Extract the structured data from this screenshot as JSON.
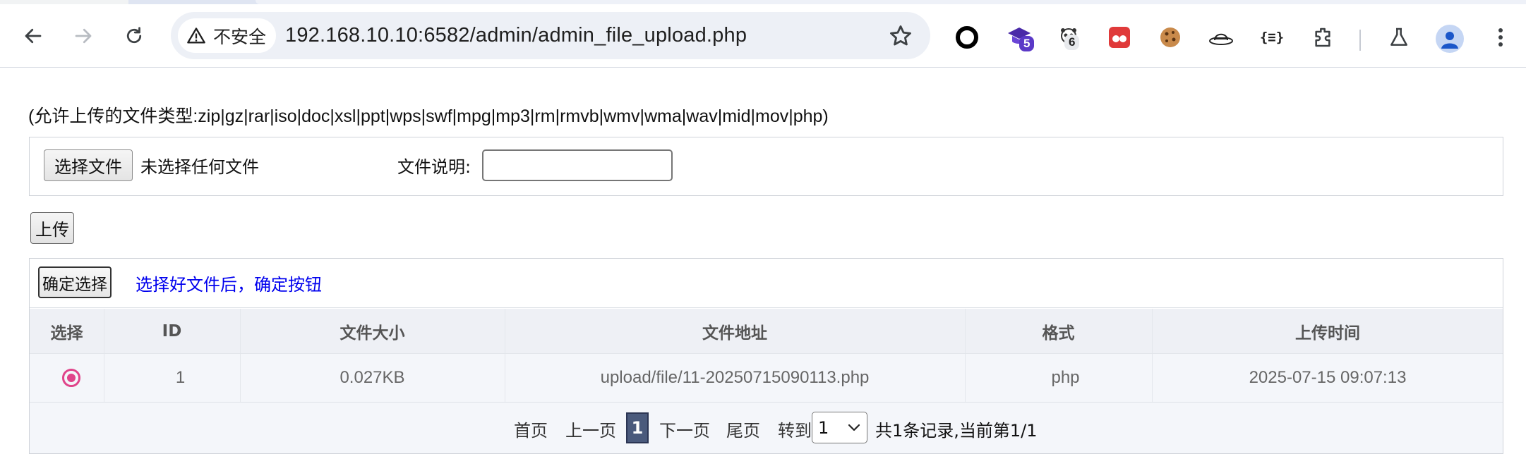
{
  "browser": {
    "security_label": "不安全",
    "url": "192.168.10.10:6582/admin/admin_file_upload.php",
    "extensions": [
      {
        "name": "circle-extension",
        "badge": ""
      },
      {
        "name": "graduation-cap-extension",
        "badge": "5"
      },
      {
        "name": "panda-extension",
        "badge": "6"
      },
      {
        "name": "red-dots-extension",
        "badge": ""
      },
      {
        "name": "cookie-extension",
        "badge": ""
      },
      {
        "name": "hat-extension",
        "badge": ""
      },
      {
        "name": "json-extension",
        "label": "{≡}"
      },
      {
        "name": "puzzle-extension",
        "badge": ""
      }
    ],
    "colors": {
      "accent": "#5b39c7",
      "badge_bg": "#e8eaed"
    }
  },
  "page": {
    "allowed_types": "(允许上传的文件类型:zip|gz|rar|iso|doc|xsl|ppt|wps|swf|mpg|mp3|rm|rmvb|wmv|wma|wav|mid|mov|php)",
    "choose_file_label": "选择文件",
    "no_file_text": "未选择任何文件",
    "description_label": "文件说明:",
    "description_value": "",
    "upload_label": "上传",
    "confirm_label": "确定选择",
    "confirm_hint": "选择好文件后，确定按钮",
    "table": {
      "headers": [
        "选择",
        "ID",
        "文件大小",
        "文件地址",
        "格式",
        "上传时间"
      ],
      "rows": [
        {
          "selected": true,
          "id": "1",
          "size": "0.027KB",
          "path": "upload/file/11-20250715090113.php",
          "format": "php",
          "time": "2025-07-15 09:07:13"
        }
      ]
    },
    "pager": {
      "first": "首页",
      "prev": "上一页",
      "current": "1",
      "next": "下一页",
      "last": "尾页",
      "goto_label": "转到",
      "goto_value": "1",
      "summary": "共1条记录,当前第1/1"
    }
  }
}
